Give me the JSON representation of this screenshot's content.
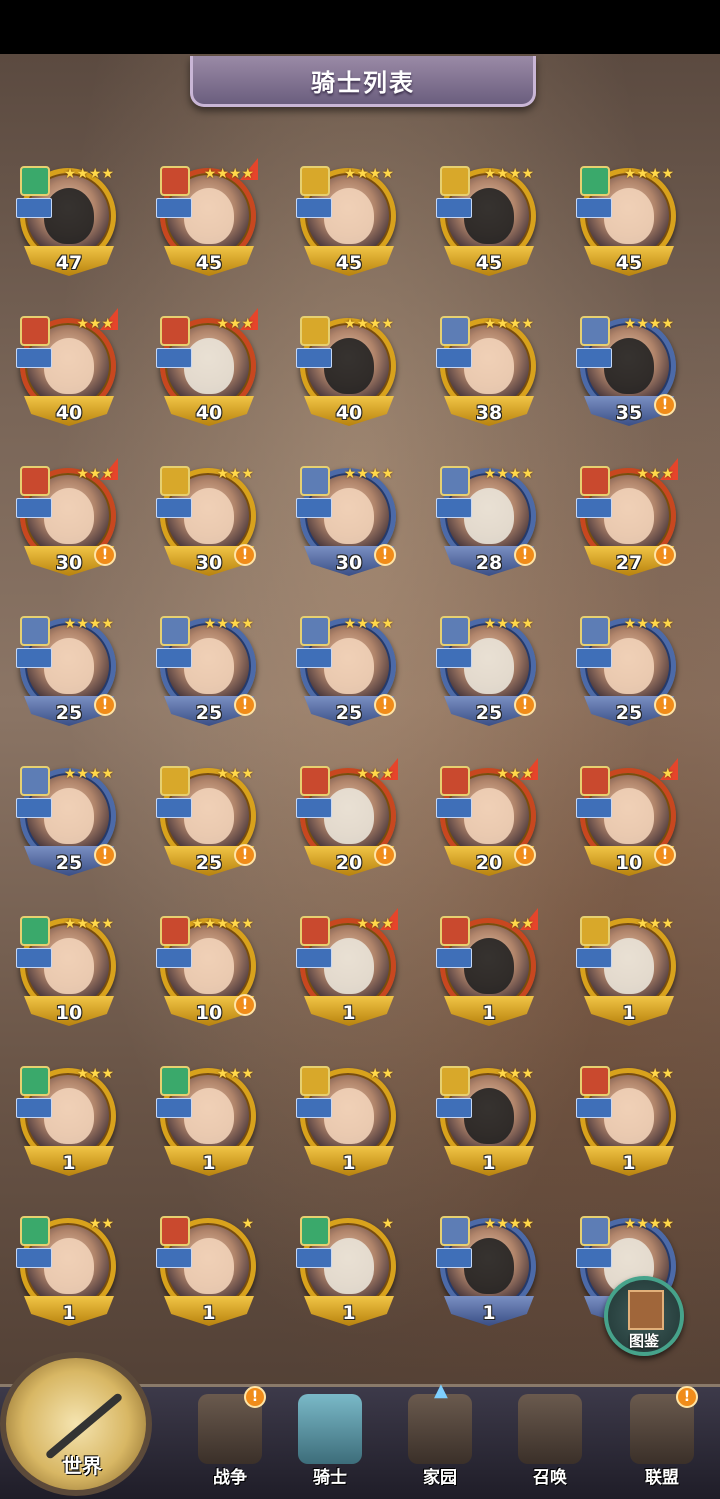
{
  "header": {
    "title": "骑士列表"
  },
  "knights": [
    {
      "level": "47",
      "stars": "★★★★",
      "frame": "gold",
      "cls": "teal",
      "face": "dark"
    },
    {
      "level": "45",
      "stars": "★★★★",
      "frame": "red",
      "cls": "red",
      "face": "skin"
    },
    {
      "level": "45",
      "stars": "★★★★",
      "frame": "gold",
      "cls": "yellow",
      "face": "skin"
    },
    {
      "level": "45",
      "stars": "★★★★",
      "frame": "gold",
      "cls": "yellow",
      "face": "dark"
    },
    {
      "level": "45",
      "stars": "★★★★",
      "frame": "gold",
      "cls": "teal",
      "face": "skin"
    },
    {
      "level": "40",
      "stars": "★★★",
      "frame": "red",
      "cls": "red",
      "face": "skin"
    },
    {
      "level": "40",
      "stars": "★★★",
      "frame": "red",
      "cls": "red",
      "face": "fur"
    },
    {
      "level": "40",
      "stars": "★★★★",
      "frame": "gold",
      "cls": "yellow",
      "face": "dark"
    },
    {
      "level": "38",
      "stars": "★★★★",
      "frame": "gold",
      "cls": "blue",
      "face": "skin"
    },
    {
      "level": "35",
      "stars": "★★★★",
      "frame": "blue",
      "cls": "blue",
      "face": "dark",
      "alert": "!"
    },
    {
      "level": "30",
      "stars": "★★★",
      "frame": "red",
      "cls": "red",
      "face": "skin",
      "alert": "!"
    },
    {
      "level": "30",
      "stars": "★★★",
      "frame": "gold",
      "cls": "yellow",
      "face": "skin",
      "alert": "!"
    },
    {
      "level": "30",
      "stars": "★★★★",
      "frame": "blue",
      "cls": "blue",
      "face": "skin",
      "alert": "!"
    },
    {
      "level": "28",
      "stars": "★★★★",
      "frame": "blue",
      "cls": "blue",
      "face": "fur",
      "alert": "!"
    },
    {
      "level": "27",
      "stars": "★★★",
      "frame": "red",
      "cls": "red",
      "face": "skin",
      "alert": "!"
    },
    {
      "level": "25",
      "stars": "★★★★",
      "frame": "blue",
      "cls": "blue",
      "face": "skin",
      "alert": "!"
    },
    {
      "level": "25",
      "stars": "★★★★",
      "frame": "blue",
      "cls": "blue",
      "face": "skin",
      "alert": "!"
    },
    {
      "level": "25",
      "stars": "★★★★",
      "frame": "blue",
      "cls": "blue",
      "face": "skin",
      "alert": "!"
    },
    {
      "level": "25",
      "stars": "★★★★",
      "frame": "blue",
      "cls": "blue",
      "face": "fur",
      "alert": "!"
    },
    {
      "level": "25",
      "stars": "★★★★",
      "frame": "blue",
      "cls": "blue",
      "face": "skin",
      "alert": "!"
    },
    {
      "level": "25",
      "stars": "★★★★",
      "frame": "blue",
      "cls": "blue",
      "face": "skin",
      "alert": "!"
    },
    {
      "level": "25",
      "stars": "★★★",
      "frame": "gold",
      "cls": "yellow",
      "face": "skin",
      "alert": "!"
    },
    {
      "level": "20",
      "stars": "★★★",
      "frame": "red",
      "cls": "red",
      "face": "fur",
      "alert": "!"
    },
    {
      "level": "20",
      "stars": "★★★",
      "frame": "red",
      "cls": "red",
      "face": "skin",
      "alert": "!"
    },
    {
      "level": "10",
      "stars": "★",
      "frame": "red",
      "cls": "red",
      "face": "skin",
      "alert": "!"
    },
    {
      "level": "10",
      "stars": "★★★★",
      "frame": "gold",
      "cls": "teal",
      "face": "skin"
    },
    {
      "level": "10",
      "stars": "★★★★★",
      "frame": "gold",
      "cls": "red",
      "face": "skin",
      "alert": "!"
    },
    {
      "level": "1",
      "stars": "★★★",
      "frame": "red",
      "cls": "red",
      "face": "fur"
    },
    {
      "level": "1",
      "stars": "★★",
      "frame": "red",
      "cls": "red",
      "face": "dark"
    },
    {
      "level": "1",
      "stars": "★★★",
      "frame": "gold",
      "cls": "yellow",
      "face": "fur"
    },
    {
      "level": "1",
      "stars": "★★★",
      "frame": "gold",
      "cls": "teal",
      "face": "skin"
    },
    {
      "level": "1",
      "stars": "★★★",
      "frame": "gold",
      "cls": "teal",
      "face": "skin"
    },
    {
      "level": "1",
      "stars": "★★",
      "frame": "gold",
      "cls": "yellow",
      "face": "skin"
    },
    {
      "level": "1",
      "stars": "★★★",
      "frame": "gold",
      "cls": "yellow",
      "face": "dark"
    },
    {
      "level": "1",
      "stars": "★★",
      "frame": "gold",
      "cls": "red",
      "face": "skin"
    },
    {
      "level": "1",
      "stars": "★★",
      "frame": "gold",
      "cls": "teal",
      "face": "skin"
    },
    {
      "level": "1",
      "stars": "★",
      "frame": "gold",
      "cls": "red",
      "face": "skin"
    },
    {
      "level": "1",
      "stars": "★",
      "frame": "gold",
      "cls": "teal",
      "face": "fur"
    },
    {
      "level": "1",
      "stars": "★★★★",
      "frame": "blue",
      "cls": "blue",
      "face": "dark"
    },
    {
      "level": "1",
      "stars": "★★★★",
      "frame": "blue",
      "cls": "blue",
      "face": "fur"
    }
  ],
  "album_button": {
    "label": "图鉴"
  },
  "compass": {
    "label": "世界"
  },
  "nav": [
    {
      "label": "战争",
      "badge": "!"
    },
    {
      "label": "骑士",
      "badge": ""
    },
    {
      "label": "家园",
      "badge": ""
    },
    {
      "label": "召唤",
      "badge": ""
    },
    {
      "label": "联盟",
      "badge": "!"
    }
  ]
}
